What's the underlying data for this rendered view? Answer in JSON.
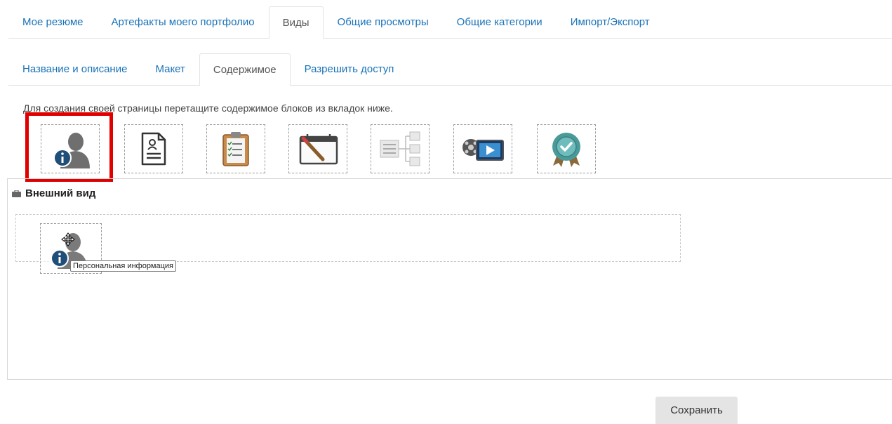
{
  "main_tabs": [
    "Мое резюме",
    "Артефакты моего портфолио",
    "Виды",
    "Общие просмотры",
    "Общие категории",
    "Импорт/Экспорт"
  ],
  "main_active": "Виды",
  "sub_tabs": [
    "Название и описание",
    "Макет",
    "Содержимое",
    "Разрешить доступ"
  ],
  "sub_active": "Содержимое",
  "instruction": "Для создания своей страницы перетащите содержимое блоков из вкладок ниже.",
  "palette": [
    {
      "icon": "personal-info-icon"
    },
    {
      "icon": "resume-document-icon"
    },
    {
      "icon": "checklist-clipboard-icon"
    },
    {
      "icon": "calendar-notepad-icon"
    },
    {
      "icon": "tree-structure-icon"
    },
    {
      "icon": "video-media-icon"
    },
    {
      "icon": "badge-certificate-icon"
    }
  ],
  "section": {
    "title": "Внешний вид",
    "icon": "briefcase-icon"
  },
  "dragged": {
    "icon": "personal-info-icon",
    "tooltip": "Персональная информация"
  },
  "save_label": "Сохранить",
  "colors": {
    "link": "#1a73b8",
    "highlight": "#e00000",
    "button_bg": "#e4e4e4"
  }
}
